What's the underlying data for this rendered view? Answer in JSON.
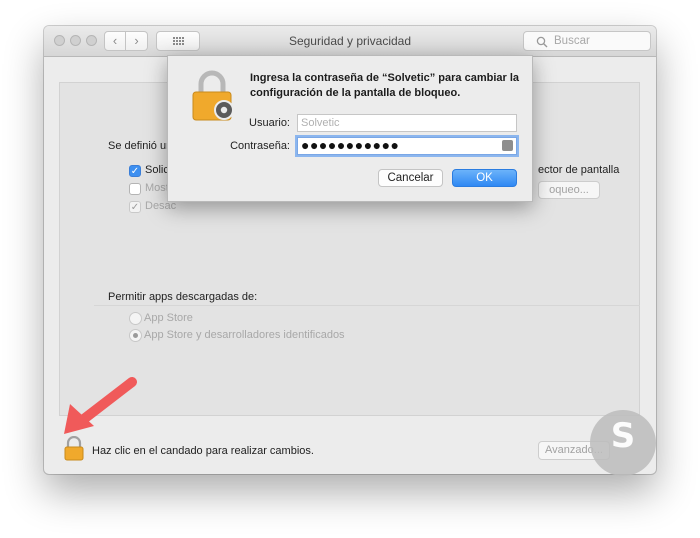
{
  "window": {
    "title": "Seguridad y privacidad",
    "search_placeholder": "Buscar"
  },
  "panel": {
    "section1_label": "Se definió un",
    "options": [
      {
        "label": "Solici",
        "checked": true
      },
      {
        "label": "Mostr",
        "checked": false
      },
      {
        "label": "Desac",
        "checked": true
      }
    ],
    "right_label_partial": "ector de pantalla",
    "right_button_partial": "oqueo...",
    "downloads_label": "Permitir apps descargadas de:",
    "radios": [
      {
        "label": "App Store",
        "selected": false
      },
      {
        "label": "App Store y desarrolladores identificados",
        "selected": true
      }
    ]
  },
  "footer": {
    "lock_text": "Haz clic en el candado para realizar cambios.",
    "advanced_button": "Avanzado..."
  },
  "dialog": {
    "message": "Ingresa la contraseña de “Solvetic” para cambiar la configuración de la pantalla de bloqueo.",
    "user_label": "Usuario:",
    "user_value": "Solvetic",
    "password_label": "Contraseña:",
    "password_value": "●●●●●●●●●●●",
    "cancel_label": "Cancelar",
    "ok_label": "OK"
  },
  "colors": {
    "accent": "#3d8ff0",
    "arrow": "#f05a5a",
    "lock": "#f0a92c"
  },
  "icons": {
    "traffic_lights": "window-controls",
    "back": "chevron-left-icon",
    "forward": "chevron-right-icon",
    "grid": "grid-icon",
    "search": "search-icon",
    "lock": "lock-icon",
    "arrow": "arrow-annotation",
    "watermark": "watermark-logo"
  }
}
